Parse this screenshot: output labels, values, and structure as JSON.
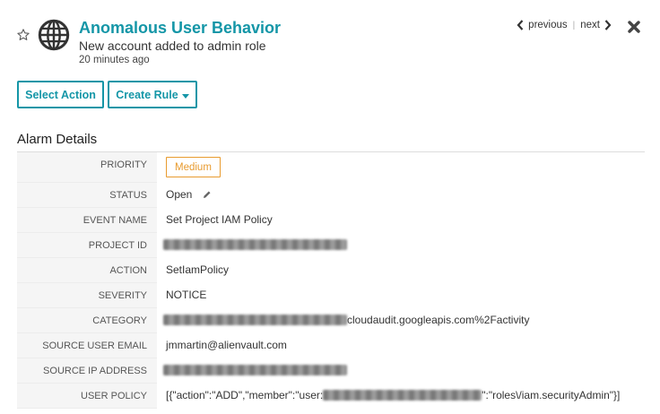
{
  "header": {
    "title": "Anomalous User Behavior",
    "subtitle": "New account added to admin role",
    "time_ago": "20 minutes ago"
  },
  "nav": {
    "previous_label": "previous",
    "separator": "|",
    "next_label": "next"
  },
  "actions": {
    "select_action_label": "Select Action",
    "create_rule_label": "Create Rule"
  },
  "details": {
    "section_title": "Alarm Details",
    "priority": {
      "label": "PRIORITY",
      "value": "Medium"
    },
    "status": {
      "label": "STATUS",
      "value": "Open"
    },
    "event_name": {
      "label": "EVENT NAME",
      "value": "Set Project IAM Policy"
    },
    "project_id": {
      "label": "PROJECT ID"
    },
    "action": {
      "label": "ACTION",
      "value": "SetIamPolicy"
    },
    "severity": {
      "label": "SEVERITY",
      "value": "NOTICE"
    },
    "category": {
      "label": "CATEGORY",
      "value_suffix": "cloudaudit.googleapis.com%2Factivity"
    },
    "source_user_email": {
      "label": "SOURCE USER EMAIL",
      "value": "jmmartin@alienvault.com"
    },
    "source_ip_address": {
      "label": "SOURCE IP ADDRESS"
    },
    "user_policy": {
      "label": "USER POLICY",
      "value_prefix": "[{\"action\":\"ADD\",\"member\":\"user:",
      "value_suffix": "\":\"roles\\/iam.securityAdmin\"}]"
    }
  },
  "colors": {
    "accent": "#1496a7",
    "priority_medium": "#e89b2f"
  }
}
